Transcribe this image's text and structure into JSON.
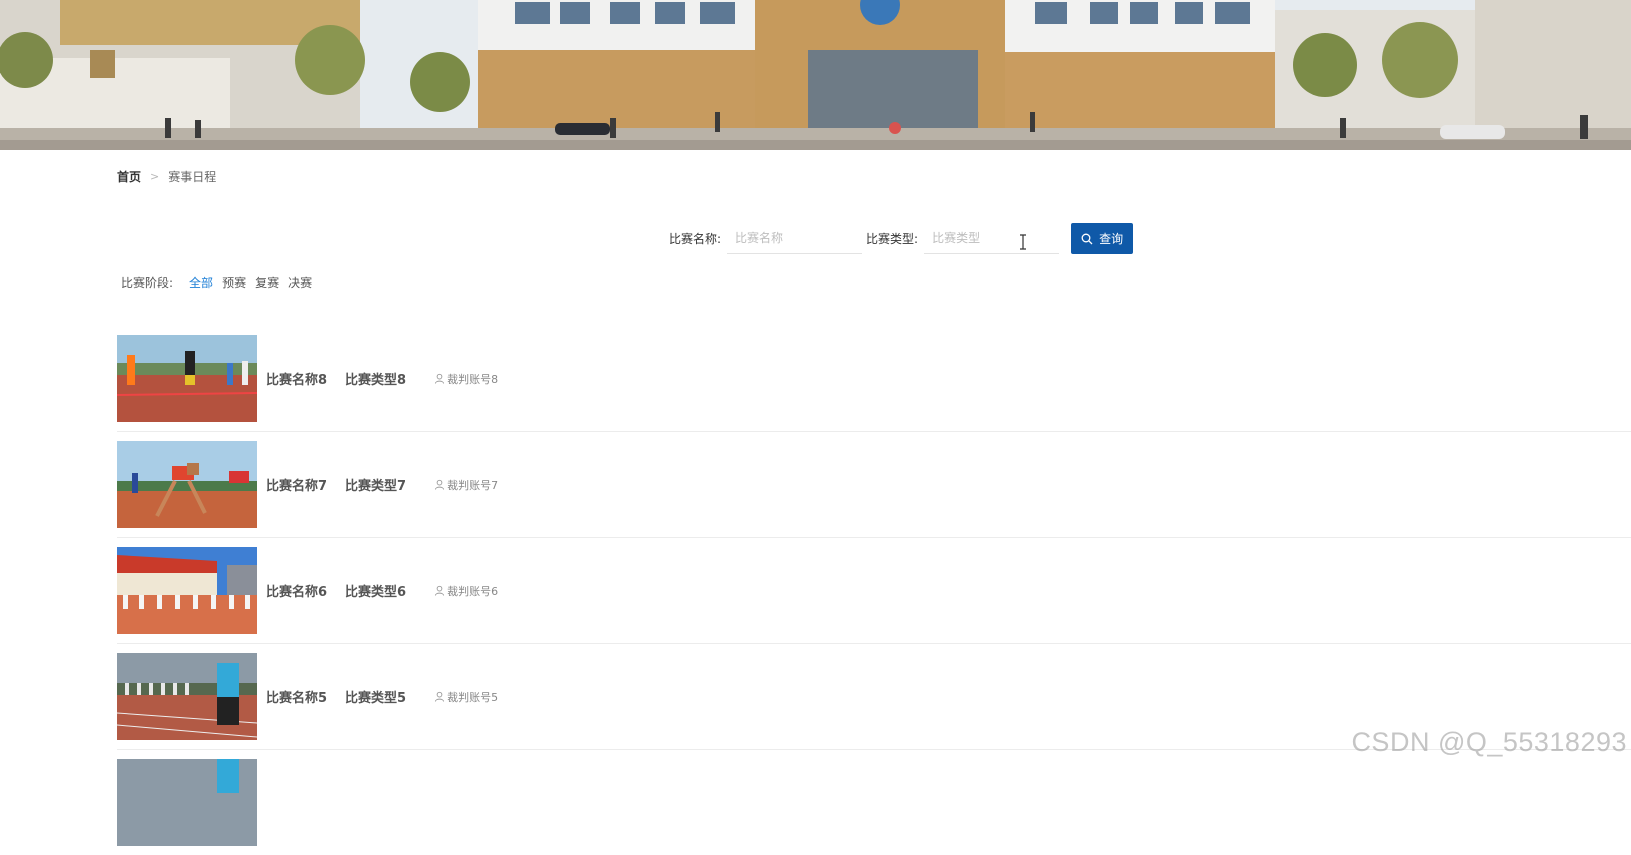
{
  "breadcrumb": {
    "home": "首页",
    "separator": ">",
    "current": "赛事日程"
  },
  "search": {
    "name_label": "比赛名称:",
    "name_placeholder": "比赛名称",
    "type_label": "比赛类型:",
    "type_placeholder": "比赛类型",
    "button_label": "查询",
    "button_icon": "search-icon",
    "button_color": "#0f59a8"
  },
  "filter": {
    "label": "比赛阶段:",
    "options": [
      "全部",
      "预赛",
      "复赛",
      "决赛"
    ],
    "active_index": 0,
    "active_color": "#1e7fd6"
  },
  "list": {
    "items": [
      {
        "name": "比赛名称8",
        "type": "比赛类型8",
        "judge": "裁判账号8",
        "judge_icon": "user-icon"
      },
      {
        "name": "比赛名称7",
        "type": "比赛类型7",
        "judge": "裁判账号7",
        "judge_icon": "user-icon"
      },
      {
        "name": "比赛名称6",
        "type": "比赛类型6",
        "judge": "裁判账号6",
        "judge_icon": "user-icon"
      },
      {
        "name": "比赛名称5",
        "type": "比赛类型5",
        "judge": "裁判账号5",
        "judge_icon": "user-icon"
      }
    ]
  },
  "watermark": "CSDN @Q_55318293"
}
